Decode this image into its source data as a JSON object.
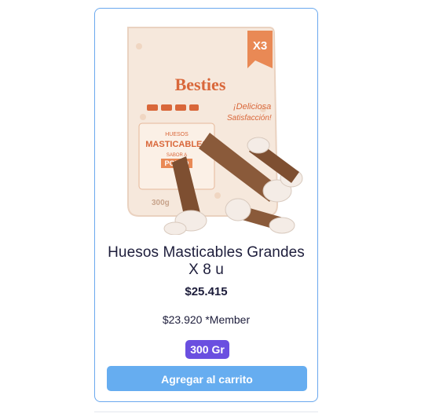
{
  "product": {
    "title": "Huesos Masticables Grandes X 8 u",
    "price": "$25.415",
    "member_price": "$23.920 *Member",
    "weight_badge": "300 Gr",
    "add_to_cart_label": "Agregar al carrito",
    "image": {
      "brand": "Besties",
      "pack_badge": "X3",
      "package_line1": "HUESOS",
      "package_line2": "MASTICABLES",
      "package_flavor": "SABOR A",
      "package_flavor2": "POLLO",
      "package_slogan1": "¡Deliciosa",
      "package_slogan2": "Satisfacción!",
      "package_weight": "300g"
    }
  },
  "colors": {
    "card_border": "#6aa8ee",
    "title_text": "#1d1d3b",
    "badge_bg": "#6a4fe0",
    "button_bg": "#66adf0"
  }
}
